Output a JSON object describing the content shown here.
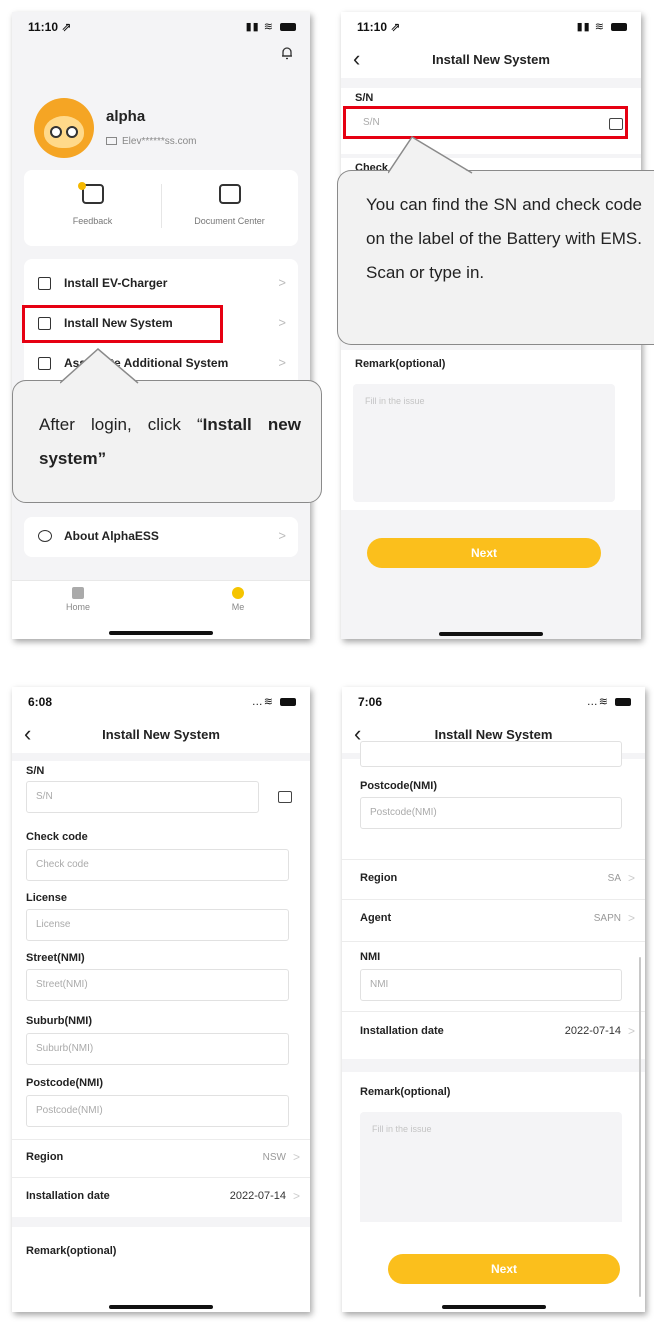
{
  "p1": {
    "time": "11:10 ⇗",
    "user_name": "alpha",
    "user_email": "Elev******ss.com",
    "quick": [
      {
        "label": "Feedback",
        "icon": "feedback-icon"
      },
      {
        "label": "Document Center",
        "icon": "document-center-icon"
      }
    ],
    "menu": [
      {
        "label": "Install EV-Charger",
        "icon": "ev-charger-icon"
      },
      {
        "label": "Install New System",
        "icon": "install-system-icon"
      },
      {
        "label": "Associate Additional System",
        "icon": "associate-system-icon"
      }
    ],
    "about": "About AlphaESS",
    "tabs": [
      {
        "label": "Home",
        "icon": "home-icon"
      },
      {
        "label": "Me",
        "icon": "me-icon"
      }
    ],
    "callout_text_a": "After login, click “",
    "callout_text_b": "Install new system",
    "callout_text_c": "”"
  },
  "p2": {
    "time": "11:10 ⇗",
    "title": "Install New System",
    "sn_label": "S/N",
    "sn_placeholder": "S/N",
    "check_label_partial": "Check",
    "callout": "You can find the SN  and check code on the label of the Battery with EMS. Scan or type in.",
    "remark_label": "Remark(optional)",
    "remark_placeholder": "Fill in the issue",
    "next": "Next"
  },
  "p3": {
    "time": "6:08",
    "title": "Install New System",
    "fields": [
      {
        "label": "S/N",
        "placeholder": "S/N"
      },
      {
        "label": "Check code",
        "placeholder": "Check code"
      },
      {
        "label": "License",
        "placeholder": "License"
      },
      {
        "label": "Street(NMI)",
        "placeholder": "Street(NMI)"
      },
      {
        "label": "Suburb(NMI)",
        "placeholder": "Suburb(NMI)"
      },
      {
        "label": "Postcode(NMI)",
        "placeholder": "Postcode(NMI)"
      }
    ],
    "region_label": "Region",
    "region_value": "NSW",
    "date_label": "Installation date",
    "date_value": "2022-07-14",
    "remark_label": "Remark(optional)"
  },
  "p4": {
    "time": "7:06",
    "title": "Install New System",
    "postcode_label": "Postcode(NMI)",
    "postcode_placeholder": "Postcode(NMI)",
    "region_label": "Region",
    "region_value": "SA",
    "agent_label": "Agent",
    "agent_value": "SAPN",
    "nmi_label": "NMI",
    "nmi_placeholder": "NMI",
    "date_label": "Installation date",
    "date_value": "2022-07-14",
    "remark_label": "Remark(optional)",
    "remark_placeholder": "Fill in the issue",
    "next": "Next"
  },
  "colors": {
    "accent": "#fbbf1c",
    "highlight": "#e60012",
    "callout_bg": "#f2f2f2"
  }
}
